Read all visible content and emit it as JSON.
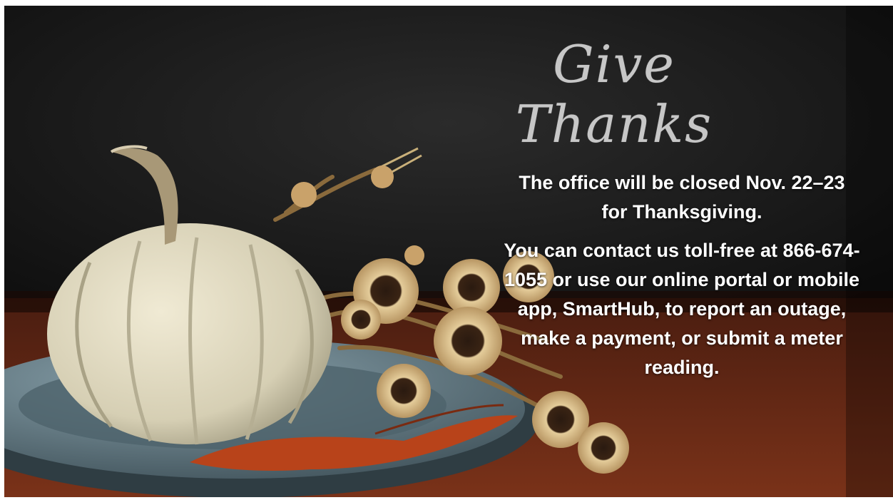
{
  "banner": {
    "title": "Give Thanks",
    "closure_notice": "The office will be closed Nov. 22–23 for Thanksgiving.",
    "contact_notice": "You can contact us toll-free at 866-674-1055 or use our online portal or mobile app, SmartHub, to report an outage, make a payment, or submit a meter reading."
  },
  "colors": {
    "chalkboard": "#141414",
    "table": "#6e2b16",
    "pumpkin": "#ddd6be",
    "plate": "#5e7580",
    "text": "#ffffff"
  }
}
